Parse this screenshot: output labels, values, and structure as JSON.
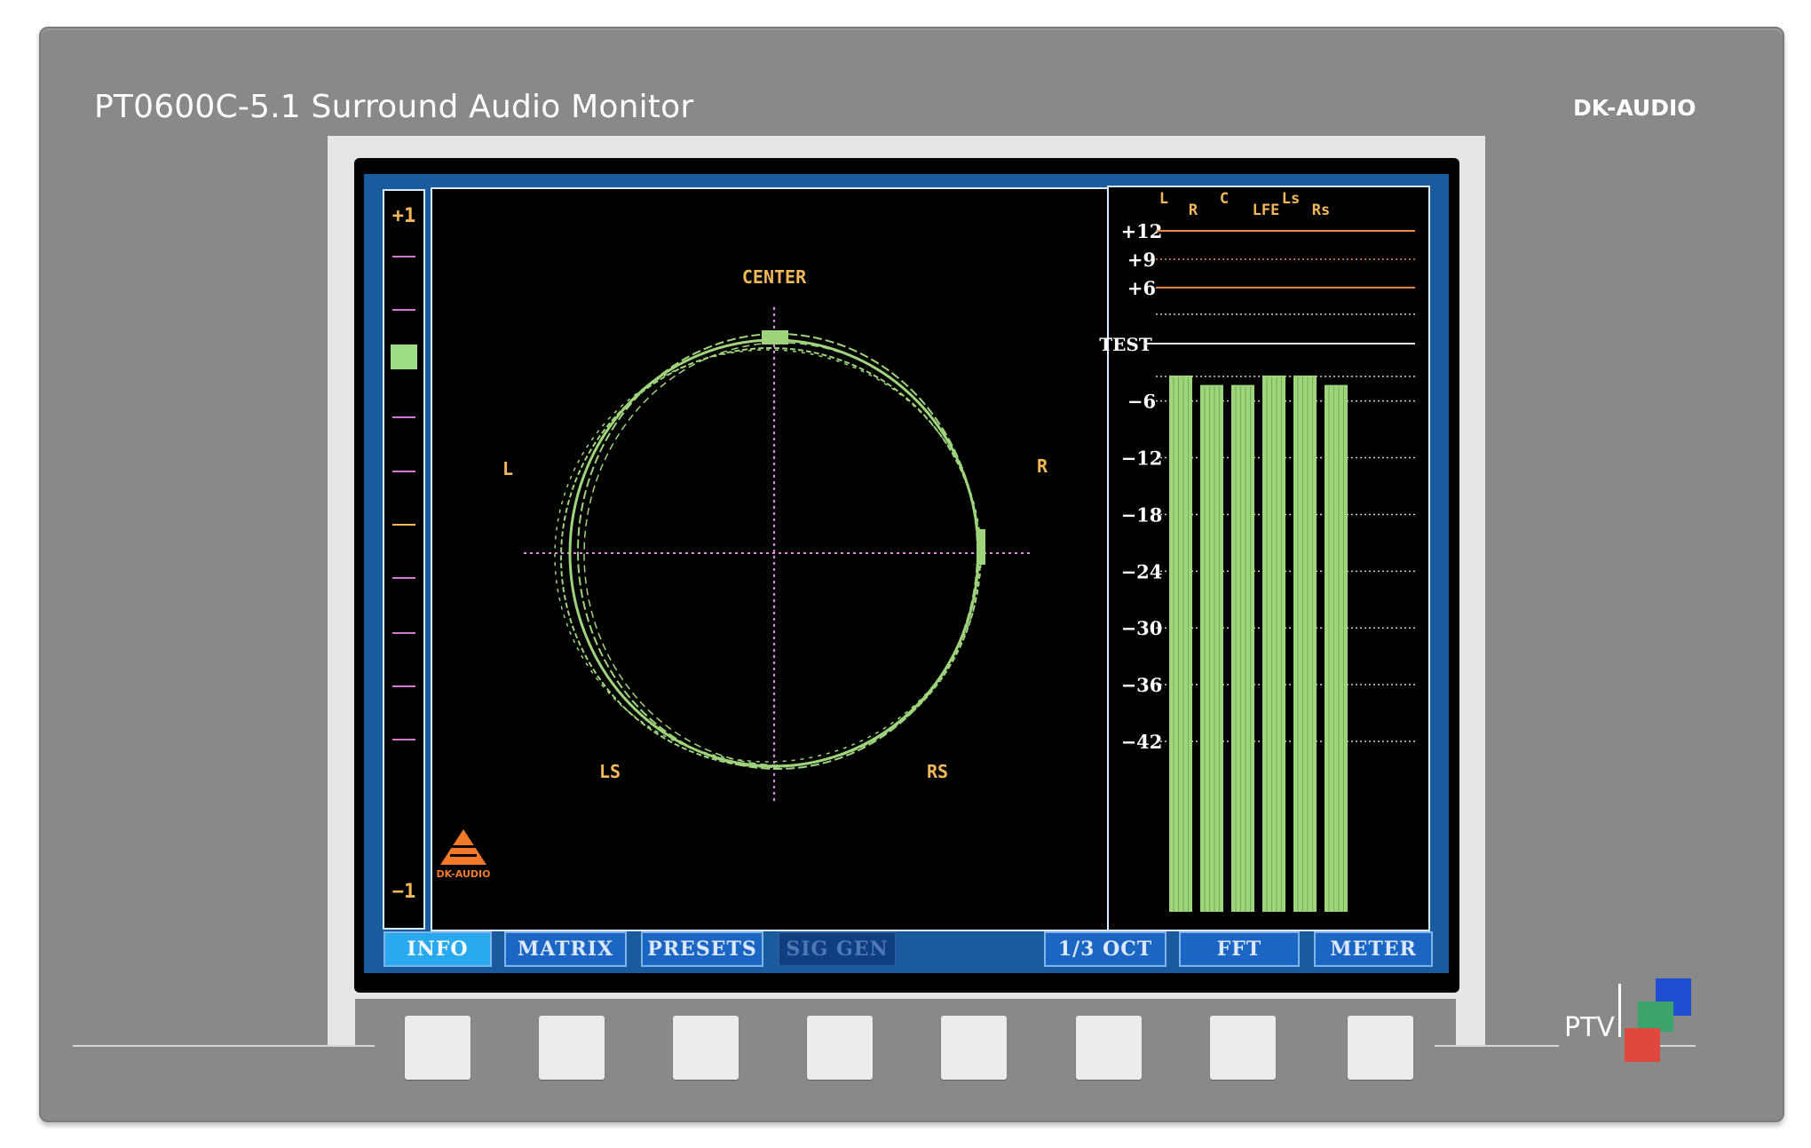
{
  "device": {
    "title": "PT0600C-5.1 Surround Audio Monitor",
    "brand": "DK-AUDIO",
    "logo_text": "PTV",
    "colors": {
      "case": "#898989",
      "bezel": "#e6e6e6",
      "lcd_bg": "#1a5a9e"
    }
  },
  "correlation_meter": {
    "top_label": "+1",
    "bottom_label": "−1",
    "level": 0.6
  },
  "vectorscope": {
    "labels": {
      "center": "CENTER",
      "left": "L",
      "right": "R",
      "ls": "LS",
      "rs": "RS"
    },
    "logo_text": "DK-AUDIO"
  },
  "level_meter": {
    "channels": [
      "L",
      "R",
      "C",
      "LFE",
      "Ls",
      "Rs"
    ],
    "scale": [
      "+12",
      "+9",
      "+6",
      "TEST",
      "−6",
      "−12",
      "−18",
      "−24",
      "−30",
      "−36",
      "−42"
    ],
    "levels_db": [
      -3.3,
      -4.3,
      -4.3,
      -3.3,
      -3.3,
      -4.3
    ],
    "colors": {
      "bar": "#9ed47c",
      "upper_lines": "#e8894f"
    }
  },
  "menu": {
    "buttons": [
      {
        "label": "INFO",
        "state": "active"
      },
      {
        "label": "MATRIX",
        "state": "normal"
      },
      {
        "label": "PRESETS",
        "state": "normal"
      },
      {
        "label": "SIG GEN",
        "state": "disabled"
      },
      {
        "label": "1/3 OCT",
        "state": "normal"
      },
      {
        "label": "FFT",
        "state": "normal"
      },
      {
        "label": "METER",
        "state": "normal"
      }
    ]
  }
}
